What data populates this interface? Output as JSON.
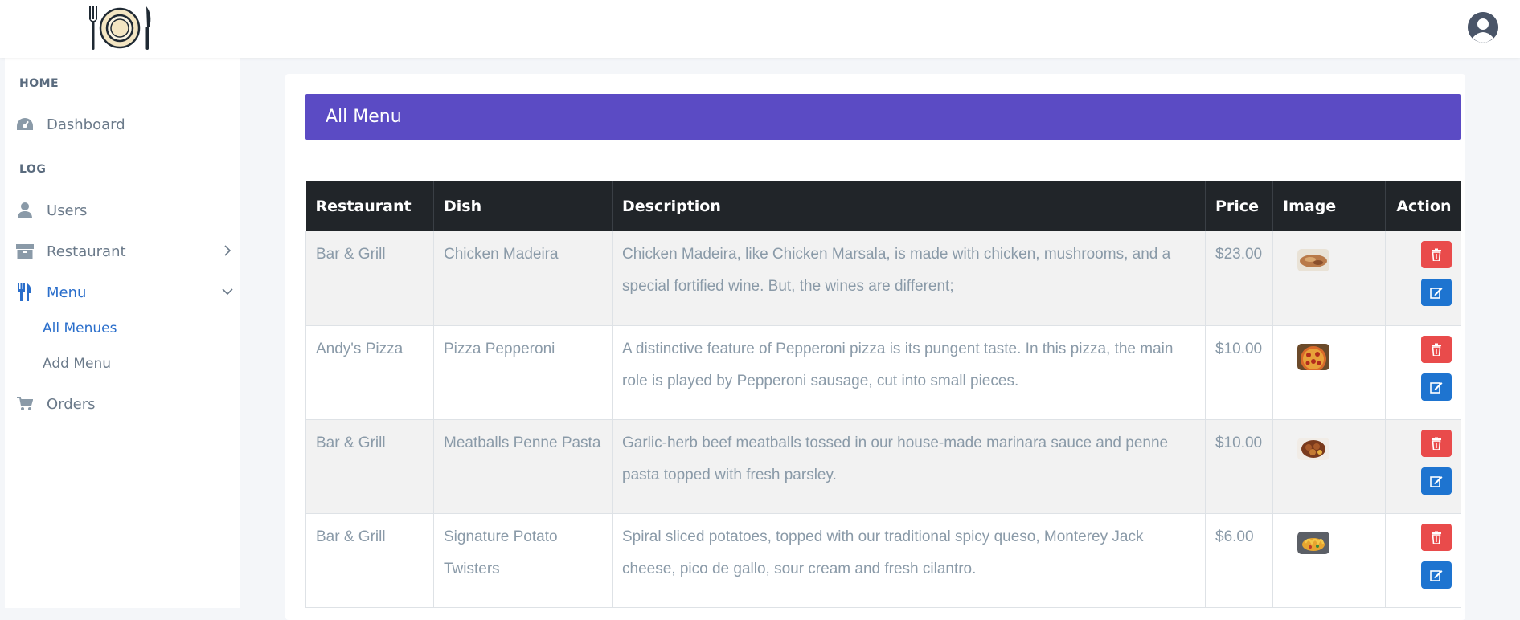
{
  "sidebar": {
    "home_heading": "HOME",
    "dashboard": "Dashboard",
    "log_heading": "LOG",
    "users": "Users",
    "restaurant": "Restaurant",
    "menu": "Menu",
    "all_menues": "All Menues",
    "add_menu": "Add Menu",
    "orders": "Orders"
  },
  "card": {
    "title": "All Menu"
  },
  "table": {
    "headers": [
      "Restaurant",
      "Dish",
      "Description",
      "Price",
      "Image",
      "Action"
    ],
    "rows": [
      {
        "restaurant": "Bar & Grill",
        "dish": "Chicken Madeira",
        "description": "Chicken Madeira, like Chicken Marsala, is made with chicken, mushrooms, and a special fortified wine. But, the wines are different;",
        "price": "$23.00"
      },
      {
        "restaurant": "Andy's Pizza",
        "dish": "Pizza Pepperoni",
        "description": "A distinctive feature of Pepperoni pizza is its pungent taste. In this pizza, the main role is played by Pepperoni sausage, cut into small pieces.",
        "price": "$10.00"
      },
      {
        "restaurant": "Bar & Grill",
        "dish": "Meatballs Penne Pasta",
        "description": "Garlic-herb beef meatballs tossed in our house-made marinara sauce and penne pasta topped with fresh parsley.",
        "price": "$10.00"
      },
      {
        "restaurant": "Bar & Grill",
        "dish": "Signature Potato Twisters",
        "description": "Spiral sliced potatoes, topped with our traditional spicy queso, Monterey Jack cheese, pico de gallo, sour cream and fresh cilantro.",
        "price": "$6.00"
      }
    ]
  },
  "colors": {
    "header_purple": "#5b4bc4",
    "active_blue": "#2a6ecb",
    "delete_red": "#e94b4b",
    "edit_blue": "#1e74d0",
    "table_head": "#212529"
  },
  "icons": [
    "restaurant-logo-icon",
    "user-avatar-icon",
    "dashboard-icon",
    "user-icon",
    "archive-icon",
    "utensils-icon",
    "cart-icon",
    "trash-icon",
    "edit-icon"
  ]
}
